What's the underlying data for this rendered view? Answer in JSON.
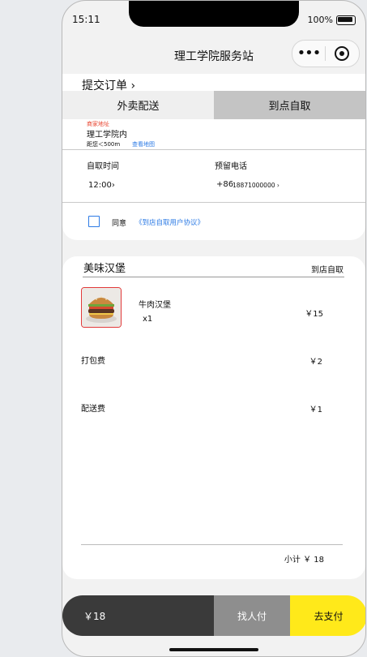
{
  "status_bar": {
    "time": "15:11",
    "battery": "100%"
  },
  "nav": {
    "title": "理工学院服务站"
  },
  "order": {
    "submit_title": "提交订单",
    "tabs": [
      {
        "label": "外卖配送"
      },
      {
        "label": "到点自取"
      }
    ],
    "address_label": "商家地址",
    "address_value": "理工学院内",
    "distance": "距您＜500m",
    "view_map": "查看地图",
    "pickup_time_label": "自取时间",
    "pickup_time_value": "12:00",
    "phone_label": "预留电话",
    "phone_prefix": "+86",
    "phone_value": "18871000000",
    "agree_text": "同意",
    "agree_link": "《到店自取用户协议》"
  },
  "shop": {
    "name": "美味汉堡",
    "pickup_tag": "到店自取",
    "item_name": "牛肉汉堡",
    "item_qty": "x1",
    "item_price": "￥15",
    "pack_label": "打包费",
    "pack_price": "￥2",
    "delivery_label": "配送费",
    "delivery_price": "￥1",
    "subtotal": "小计 ￥ 18"
  },
  "bottom": {
    "total": "￥18",
    "friend_pay": "找人付",
    "go_pay": "去支付"
  },
  "colors": {
    "accent_blue": "#2d7be5",
    "pay_yellow": "#ffe91a",
    "address_red": "#e8442f"
  }
}
